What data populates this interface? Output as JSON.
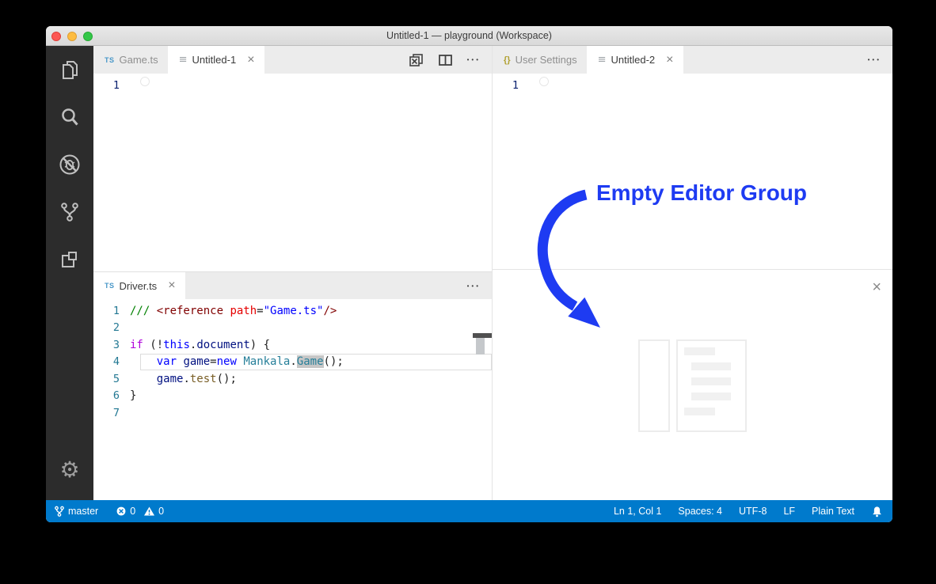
{
  "titlebar": {
    "title": "Untitled-1 — playground (Workspace)"
  },
  "activity_bar": {
    "icons": [
      "files-explorer",
      "search",
      "debug-disabled",
      "source-control-branch",
      "extensions"
    ],
    "bottom_icon": "settings-gear"
  },
  "tabs": {
    "left_top": [
      {
        "icon": "typescript",
        "label": "Game.ts",
        "active": false
      },
      {
        "icon": "untitled-file",
        "label": "Untitled-1",
        "active": true,
        "close": "×"
      }
    ],
    "right_top": [
      {
        "icon": "json-braces",
        "label": "User Settings",
        "active": false
      },
      {
        "icon": "untitled-file",
        "label": "Untitled-2",
        "active": true,
        "close": "×"
      }
    ],
    "left_bottom": [
      {
        "icon": "typescript",
        "label": "Driver.ts",
        "active": true,
        "close": "×"
      }
    ]
  },
  "editor_actions": {
    "icons": [
      "close-all-editors",
      "split-editor",
      "more-actions"
    ],
    "more_glyph": "•••"
  },
  "empty_editors": {
    "line_number": "1"
  },
  "driver_editor": {
    "lines": [
      {
        "num": "1",
        "tokens": [
          {
            "t": "/// ",
            "c": "comment"
          },
          {
            "t": "<reference",
            "c": "tag"
          },
          {
            "t": " ",
            "c": "plain"
          },
          {
            "t": "path",
            "c": "attr"
          },
          {
            "t": "=",
            "c": "plain"
          },
          {
            "t": "\"Game.ts\"",
            "c": "string"
          },
          {
            "t": "/>",
            "c": "tag"
          }
        ]
      },
      {
        "num": "2",
        "tokens": []
      },
      {
        "num": "3",
        "tokens": [
          {
            "t": "if",
            "c": "keyword2"
          },
          {
            "t": " (!",
            "c": "plain"
          },
          {
            "t": "this",
            "c": "keyword"
          },
          {
            "t": ".",
            "c": "plain"
          },
          {
            "t": "document",
            "c": "variable"
          },
          {
            "t": ") {",
            "c": "plain"
          }
        ]
      },
      {
        "num": "4",
        "current": true,
        "tokens": [
          {
            "t": "    ",
            "c": "plain"
          },
          {
            "t": "var",
            "c": "keyword"
          },
          {
            "t": " ",
            "c": "plain"
          },
          {
            "t": "game",
            "c": "variable"
          },
          {
            "t": "=",
            "c": "plain"
          },
          {
            "t": "new",
            "c": "keyword"
          },
          {
            "t": " ",
            "c": "plain"
          },
          {
            "t": "Mankala",
            "c": "type"
          },
          {
            "t": ".",
            "c": "plain"
          },
          {
            "t": "Game",
            "c": "type",
            "hl": true
          },
          {
            "t": "();",
            "c": "plain"
          }
        ]
      },
      {
        "num": "5",
        "tokens": [
          {
            "t": "    ",
            "c": "plain"
          },
          {
            "t": "game",
            "c": "variable"
          },
          {
            "t": ".",
            "c": "plain"
          },
          {
            "t": "test",
            "c": "function"
          },
          {
            "t": "();",
            "c": "plain"
          }
        ]
      },
      {
        "num": "6",
        "tokens": [
          {
            "t": "}",
            "c": "plain"
          }
        ]
      },
      {
        "num": "7",
        "tokens": []
      }
    ]
  },
  "empty_group": {
    "close": "×",
    "annotation": "Empty Editor Group"
  },
  "status_bar": {
    "branch": "master",
    "errors": "0",
    "warnings": "0",
    "cursor_position": "Ln 1, Col 1",
    "indentation": "Spaces: 4",
    "encoding": "UTF-8",
    "eol": "LF",
    "language": "Plain Text",
    "icons": [
      "git-branch",
      "errors-circle",
      "warnings-triangle",
      "notifications-bell"
    ]
  },
  "colors": {
    "status_bar": "#007acc",
    "activity_bar": "#2c2c2c",
    "tab_strip": "#ececec",
    "annotation_blue": "#1e3bf2",
    "occurrence_highlight": "#c6c6c6"
  }
}
